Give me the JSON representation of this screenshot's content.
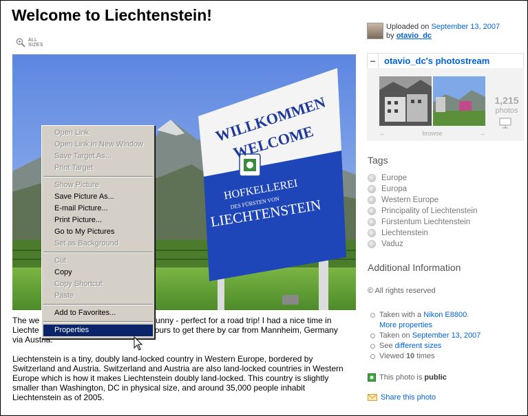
{
  "page": {
    "title": "Welcome to Liechtenstein!"
  },
  "all_sizes": {
    "label_top": "ALL",
    "label_bottom": "SIZES",
    "icon": "zoom-icon"
  },
  "photo_sign": {
    "line1": "WILLKOMMEN",
    "line2": "WELCOME",
    "line3": "HOFKELLEREI",
    "line4": "DES FÜRSTEN VON",
    "line5": "LIECHTENSTEIN"
  },
  "context_menu": {
    "items": [
      {
        "label": "Open Link",
        "disabled": true
      },
      {
        "label": "Open Link in New Window",
        "disabled": true
      },
      {
        "label": "Save Target As...",
        "disabled": true
      },
      {
        "label": "Print Target",
        "disabled": true
      },
      {
        "sep": true
      },
      {
        "label": "Show Picture",
        "disabled": true
      },
      {
        "label": "Save Picture As...",
        "disabled": false
      },
      {
        "label": "E-mail Picture...",
        "disabled": false
      },
      {
        "label": "Print Picture...",
        "disabled": false
      },
      {
        "label": "Go to My Pictures",
        "disabled": false
      },
      {
        "label": "Set as Background",
        "disabled": true
      },
      {
        "sep": true
      },
      {
        "label": "Cut",
        "disabled": true
      },
      {
        "label": "Copy",
        "disabled": false
      },
      {
        "label": "Copy Shortcut",
        "disabled": true
      },
      {
        "label": "Paste",
        "disabled": true
      },
      {
        "sep": true
      },
      {
        "label": "Add to Favorites...",
        "disabled": false
      },
      {
        "sep": true
      },
      {
        "label": "Properties",
        "disabled": false,
        "selected": true
      }
    ]
  },
  "description": {
    "p1_lines": [
      "The we",
      "nd sunny - perfect for a road trip! I had a nice time in",
      "Liechte",
      "ours to get there by car from Mannheim, Germany",
      "via Austria."
    ],
    "p2": "Liechtenstein is a tiny, doubly land-locked country in Western Europe, bordered by Switzerland and Austria. Switzerland and Austria are also land-locked countries in Western Europe which is how it makes Liechtenstein doubly land-locked. This country is slightly smaller than Washington, DC in physical size, and around 35,000 people inhabit Liechtenstein as of 2005."
  },
  "uploader": {
    "uploaded_on_prefix": "Uploaded on ",
    "date": "September 13, 2007",
    "by_prefix": "by ",
    "username": "otavio_dc"
  },
  "photostream": {
    "minus": "−",
    "title": "otavio_dc's photostream",
    "count": "1,215",
    "count_label": "photos",
    "browse": "browse"
  },
  "tags": {
    "heading": "Tags",
    "items": [
      "Europe",
      "Europa",
      "Western Europe",
      "Principality of Liechtenstein",
      "Fürstentum Liechtenstein",
      "Liechtenstein",
      "Vaduz"
    ]
  },
  "additional": {
    "heading": "Additional Information",
    "rights": "© All rights reserved",
    "taken_with_prefix": "Taken with a ",
    "camera": "Nikon E8800",
    "camera_suffix": ".",
    "more_properties": "More properties",
    "taken_on_prefix": "Taken on ",
    "taken_on_date": "September 13, 2007",
    "see_prefix": "See ",
    "different_sizes": "different sizes",
    "viewed_prefix": "Viewed ",
    "viewed_count": "10",
    "viewed_suffix": " times",
    "public_prefix": "This photo is ",
    "public_word": "public",
    "share": "Share this photo"
  },
  "colors": {
    "link": "#0063dc",
    "menu_bg": "#d4d0c8",
    "menu_highlight": "#0a246a",
    "sign_blue": "#1f46b8"
  }
}
